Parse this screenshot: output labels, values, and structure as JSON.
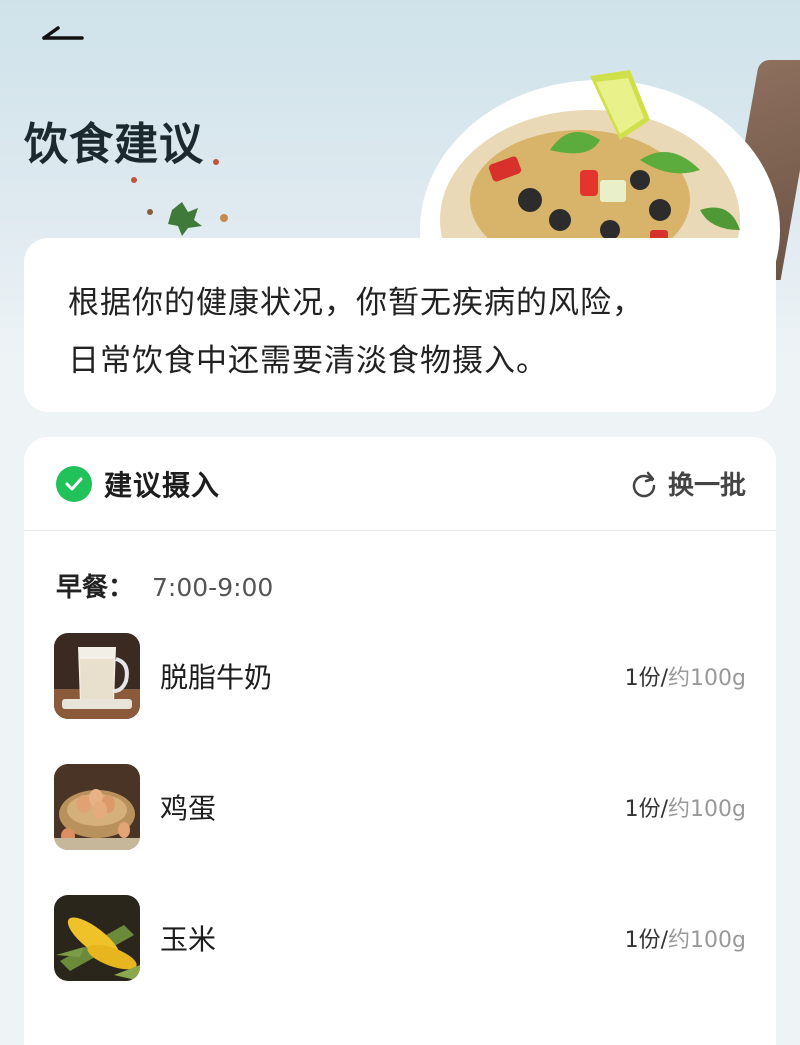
{
  "header": {
    "back_icon": "back-arrow-icon",
    "title": "饮食建议"
  },
  "summary": {
    "line1": "根据你的健康状况，你暂无疾病的风险，",
    "line2": "日常饮食中还需要清淡食物摄入。"
  },
  "recommendation": {
    "title": "建议摄入",
    "check_icon": "check-circle-icon",
    "refresh_icon": "refresh-icon",
    "refresh_label": "换一批",
    "meal": {
      "name": "早餐",
      "colon": "：",
      "time": "7:00-9:00"
    },
    "items": [
      {
        "name": "脱脂牛奶",
        "portion": "1份",
        "separator": "/",
        "approx": "约100g",
        "image": "milk-jug-image"
      },
      {
        "name": "鸡蛋",
        "portion": "1份",
        "separator": "/",
        "approx": "约100g",
        "image": "eggs-in-basket-image"
      },
      {
        "name": "玉米",
        "portion": "1份",
        "separator": "/",
        "approx": "约100g",
        "image": "corn-cobs-image"
      }
    ]
  },
  "colors": {
    "accent_green": "#21c25a",
    "title_text": "#1b2a2f",
    "card_bg": "#ffffff",
    "page_bg": "#eef3f6"
  }
}
